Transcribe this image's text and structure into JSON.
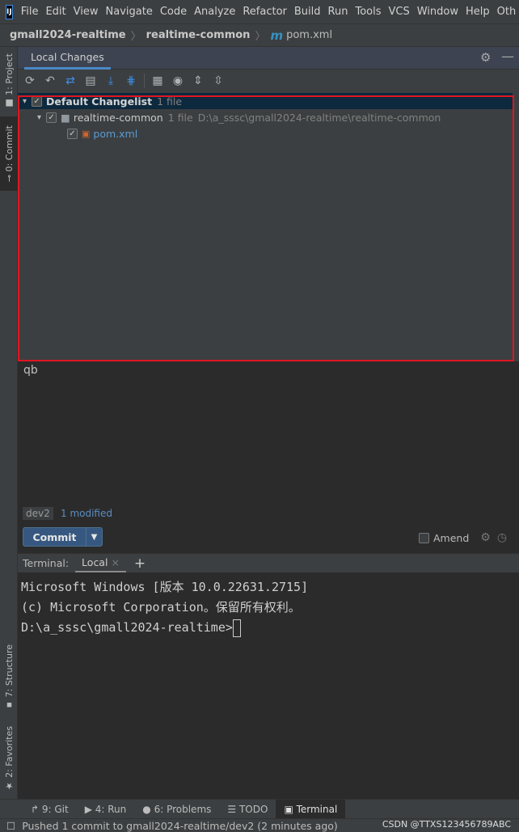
{
  "app": {
    "logo": "IJ"
  },
  "menu": [
    "File",
    "Edit",
    "View",
    "Navigate",
    "Code",
    "Analyze",
    "Refactor",
    "Build",
    "Run",
    "Tools",
    "VCS",
    "Window",
    "Help",
    "Oth"
  ],
  "breadcrumb": {
    "project": "gmall2024-realtime",
    "module": "realtime-common",
    "file_icon": "m",
    "file": "pom.xml"
  },
  "left_strip": {
    "project": "1: Project",
    "commit": "0: Commit",
    "structure": "7: Structure",
    "favorites": "2: Favorites"
  },
  "tool_window": {
    "tab": "Local Changes"
  },
  "toolbar_icons": [
    "refresh-icon",
    "rollback-icon",
    "diff-icon",
    "shelve-icon",
    "update-icon",
    "merge-icon",
    "group-by-icon",
    "eye-icon",
    "expand-all-icon",
    "collapse-all-icon"
  ],
  "tree": {
    "changelist": {
      "name": "Default Changelist",
      "count": "1 file"
    },
    "module": {
      "name": "realtime-common",
      "count": "1 file",
      "path": "D:\\a_sssc\\gmall2024-realtime\\realtime-common"
    },
    "file": {
      "name": "pom.xml",
      "color": "#5a9bd5"
    }
  },
  "commit": {
    "message": "qb",
    "branch": "dev2",
    "modified": "1 modified",
    "button": "Commit",
    "amend": "Amend"
  },
  "terminal": {
    "label": "Terminal:",
    "tab": "Local",
    "lines": [
      "Microsoft Windows [版本 10.0.22631.2715]",
      "(c) Microsoft Corporation。保留所有权利。",
      "",
      "D:\\a_sssc\\gmall2024-realtime>"
    ]
  },
  "bottom_tabs": [
    {
      "icon": "git-icon",
      "label": "9: Git"
    },
    {
      "icon": "run-icon",
      "label": "4: Run"
    },
    {
      "icon": "problems-icon",
      "label": "6: Problems"
    },
    {
      "icon": "todo-icon",
      "label": "TODO"
    },
    {
      "icon": "terminal-icon",
      "label": "Terminal",
      "active": true
    }
  ],
  "status": {
    "text": "Pushed 1 commit to gmall2024-realtime/dev2 (2 minutes ago)",
    "watermark": "CSDN @TTXS123456789ABC"
  },
  "colors": {
    "accent": "#365880",
    "highlight_border": "#e0161f",
    "selection": "#0d293e"
  }
}
